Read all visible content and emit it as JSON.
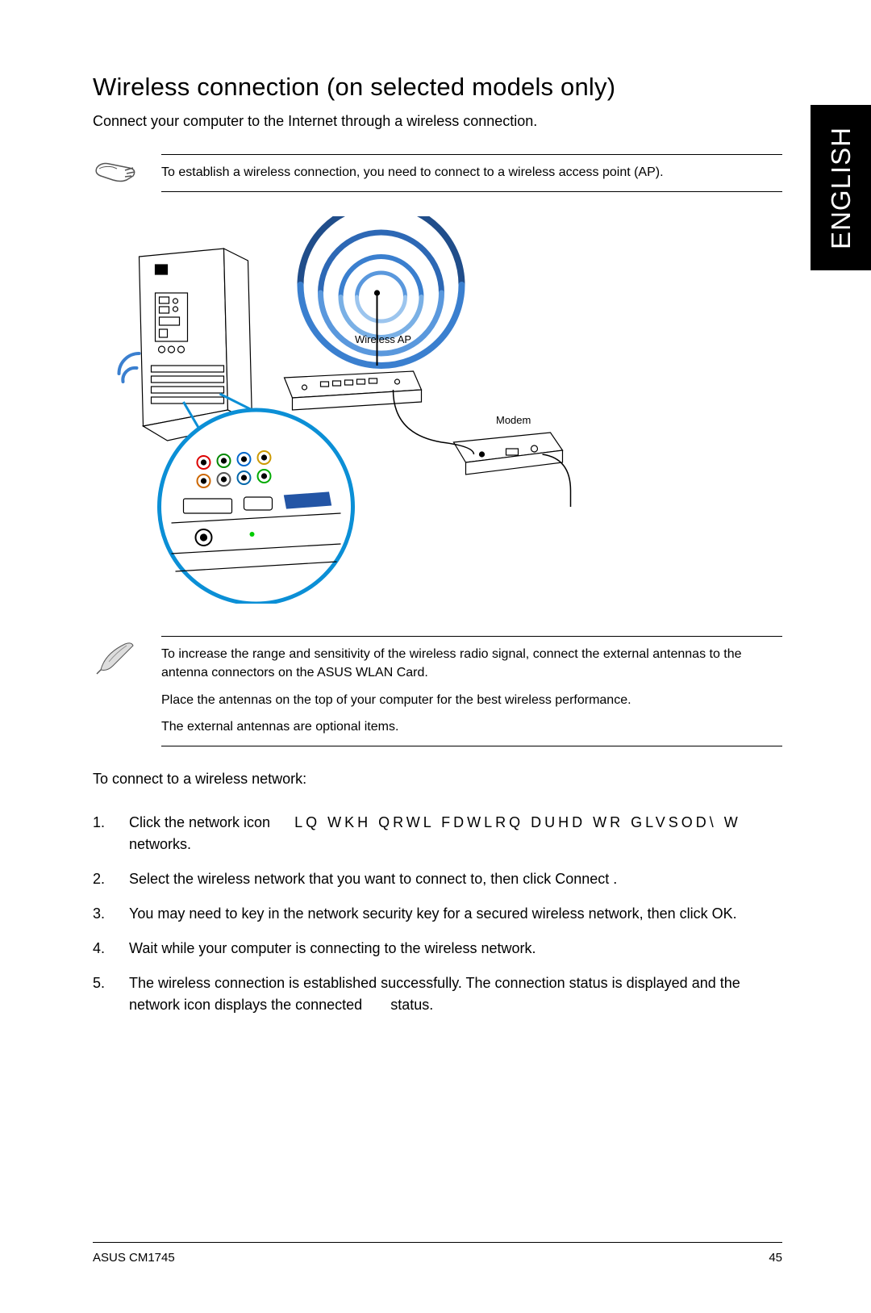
{
  "header": {
    "title": "Wireless connection (on selected models only)",
    "intro": "Connect your computer to the Internet through a wireless connection.",
    "language_tab": "ENGLISH"
  },
  "note1": {
    "text": "To establish a wireless connection, you need to connect to a wireless access point (AP)."
  },
  "diagram": {
    "wireless_ap_label": "Wireless AP",
    "modem_label": "Modem"
  },
  "note2": {
    "p1": "To increase the range and sensitivity of the wireless radio signal, connect the external antennas to the antenna connectors on the ASUS WLAN Card.",
    "p2": "Place the antennas on the top of your computer for the best wireless performance.",
    "p3": "The external antennas are optional items."
  },
  "steps_intro": "To connect to a wireless network:",
  "steps": [
    {
      "pre": "Click the network icon",
      "scrambled": "LQ WKH QRWL FDWLRQ DUHD WR GLVSOD\\ W",
      "post": "networks."
    },
    {
      "text": "Select the wireless network that you want to connect to, then click Connect ."
    },
    {
      "text": "You may need to key in the network security key for a secured wireless network, then click OK."
    },
    {
      "text": "Wait while your computer is connecting to the wireless network."
    },
    {
      "pre2": "The wireless connection is established successfully. The connection status is displayed and the network icon displays the connected",
      "post2": "status."
    }
  ],
  "footer": {
    "model": "ASUS CM1745",
    "page": "45"
  }
}
